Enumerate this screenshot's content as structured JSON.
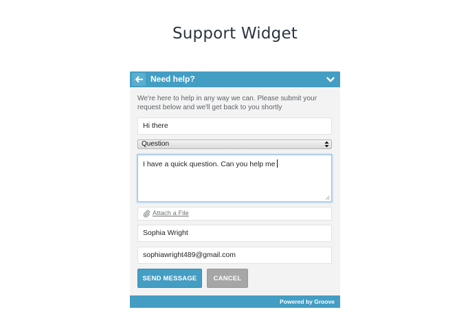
{
  "page": {
    "title": "Support Widget"
  },
  "widget": {
    "header_title": "Need help?",
    "intro_text": "We're here to help in any way we can. Please submit your request below and we'll get back to you shortly",
    "subject_value": "Hi there",
    "type_select": {
      "selected": "Question"
    },
    "message_value": "I have a quick question. Can you help me",
    "attach_label": "Attach a File",
    "name_value": "Sophia Wright",
    "email_value": "sophiawright489@gmail.com",
    "send_label": "SEND MESSAGE",
    "cancel_label": "CANCEL",
    "footer_text": "Powered by Groove"
  },
  "icons": {
    "back": "back-arrow-icon",
    "collapse": "chevron-down-icon",
    "select_arrows": "select-arrows-icon",
    "attach": "paperclip-icon",
    "resize": "resize-grip-icon"
  },
  "colors": {
    "accent": "#449dc3",
    "panel_background": "#f3f3f3",
    "cancel_button": "#a6a6a6",
    "title_text": "#2b3540"
  }
}
